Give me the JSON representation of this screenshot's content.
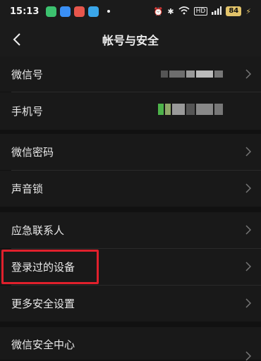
{
  "status_bar": {
    "time": "15:13",
    "network_label": "HD",
    "battery": "84",
    "app_icon_colors": [
      "#3cc26f",
      "#3a8ff5",
      "#e7564c",
      "#3aa6ea"
    ]
  },
  "header": {
    "title": "帐号与安全",
    "back_icon": "chevron-left-icon"
  },
  "rows": {
    "wechat_id": "微信号",
    "phone": "手机号",
    "password": "微信密码",
    "voice_lock": "声音锁",
    "emergency_contact": "应急联系人",
    "logged_devices": "登录过的设备",
    "more_security": "更多安全设置",
    "security_center": "微信安全中心"
  },
  "colors": {
    "highlight": "#e0202c",
    "background": "#111111",
    "row": "#191919"
  }
}
